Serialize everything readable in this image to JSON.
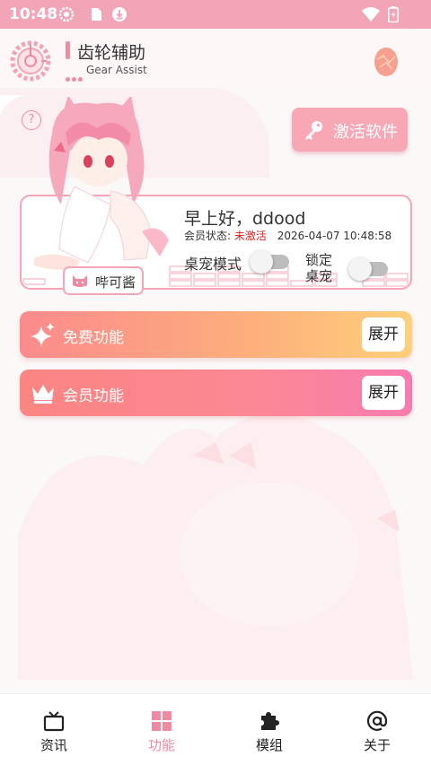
{
  "status_bar": {
    "time": "10:48"
  },
  "header": {
    "title": "齿轮辅助",
    "subtitle": "Gear Assist"
  },
  "help": {
    "label": "?"
  },
  "activate": {
    "label": "激活软件"
  },
  "info_card": {
    "greeting": "早上好，ddood",
    "member_status_label": "会员状态:",
    "member_status_value": "未激活",
    "timestamp": "2026-04-07 10:48:58",
    "desktop_pet_label": "桌宠模式",
    "lock_pet_label": "锁定桌宠",
    "pet_name": "哔可酱",
    "desktop_pet_on": false,
    "lock_pet_on": false
  },
  "features": {
    "free": {
      "label": "免费功能",
      "button": "展开"
    },
    "vip": {
      "label": "会员功能",
      "button": "展开"
    }
  },
  "nav": {
    "items": [
      {
        "label": "资讯",
        "icon": "tv-icon"
      },
      {
        "label": "功能",
        "icon": "grid-icon",
        "active": true
      },
      {
        "label": "模组",
        "icon": "puzzle-icon"
      },
      {
        "label": "关于",
        "icon": "at-icon"
      }
    ]
  },
  "colors": {
    "accent": "#f08aa0",
    "status_bar": "#f2a5b7",
    "warning_red": "#e02020"
  }
}
